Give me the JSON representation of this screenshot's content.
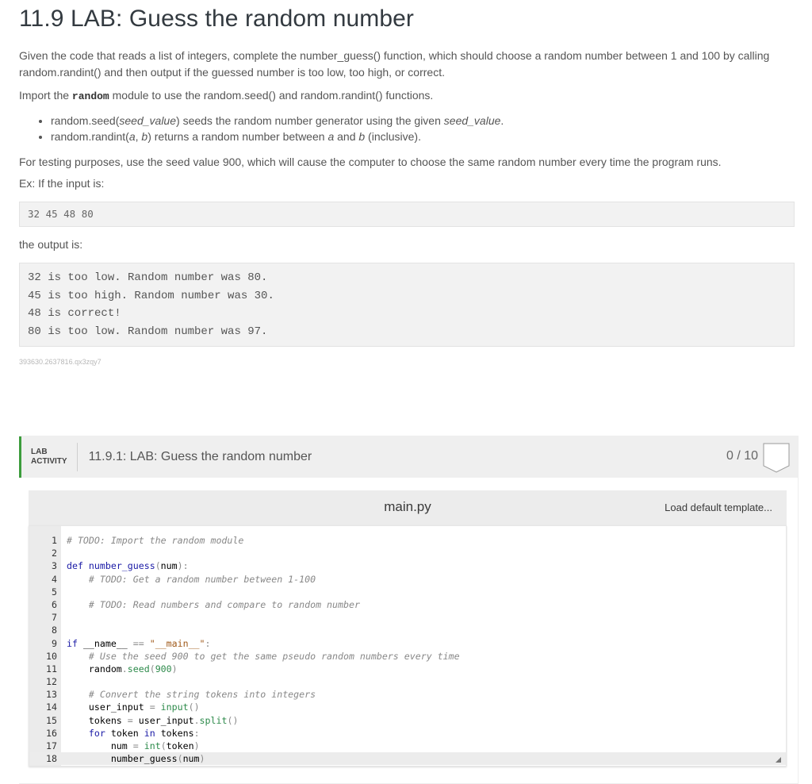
{
  "page": {
    "title": "11.9 LAB: Guess the random number",
    "intro": "Given the code that reads a list of integers, complete the number_guess() function, which should choose a random number between 1 and 100 by calling random.randint() and then output if the guessed number is too low, too high, or correct.",
    "import_prefix": "Import the ",
    "import_module": "random",
    "import_suffix": " module to use the random.seed() and random.randint() functions.",
    "bullets": [
      {
        "a": "random.seed(",
        "b": "seed_value",
        "c": ") seeds the random number generator using the given ",
        "d": "seed_value",
        "e": "."
      },
      {
        "a": "random.randint(",
        "b": "a",
        "c": ", ",
        "d": "b",
        "e": ") returns a random number between ",
        "f": "a",
        "g": " and ",
        "h": "b",
        "i": " (inclusive)."
      }
    ],
    "testing_note": "For testing purposes, use the seed value 900, which will cause the computer to choose the same random number every time the program runs.",
    "example_intro": "Ex: If the input is:",
    "example_input": "32 45 48 80",
    "output_intro": "the output is:",
    "example_output": [
      "32 is too low. Random number was 80.",
      "45 is too high. Random number was 30.",
      "48 is correct!",
      "80 is too low. Random number was 97."
    ],
    "content_id": "393630.2637816.qx3zqy7"
  },
  "lab": {
    "tag_line1": "LAB",
    "tag_line2": "ACTIVITY",
    "title": "11.9.1: LAB: Guess the random number",
    "score": "0 / 10",
    "accent_color": "#3c9c3c",
    "editor": {
      "file_name": "main.py",
      "load_template_label": "Load default template...",
      "line_numbers": [
        "1",
        "2",
        "3",
        "4",
        "5",
        "6",
        "7",
        "8",
        "9",
        "10",
        "11",
        "12",
        "13",
        "14",
        "15",
        "16",
        "17",
        "18"
      ],
      "code_lines": [
        "# TODO: Import the random module",
        "",
        "def number_guess(num):",
        "    # TODO: Get a random number between 1-100",
        "",
        "    # TODO: Read numbers and compare to random number",
        "",
        "",
        "if __name__ == \"__main__\":",
        "    # Use the seed 900 to get the same pseudo random numbers every time",
        "    random.seed(900)",
        "",
        "    # Convert the string tokens into integers",
        "    user_input = input()",
        "    tokens = user_input.split()",
        "    for token in tokens:",
        "        num = int(token)",
        "        number_guess(num)"
      ],
      "active_line": 18
    }
  }
}
